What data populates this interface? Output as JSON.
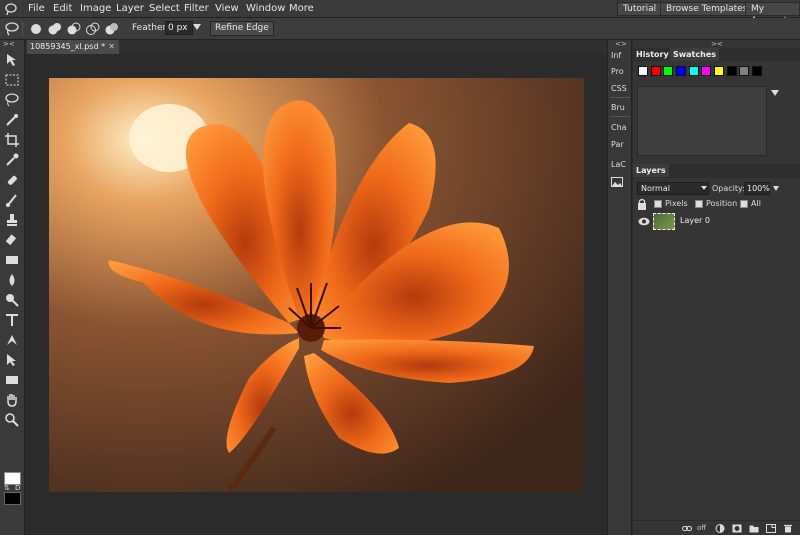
{
  "menu": {
    "items": [
      "File",
      "Edit",
      "Image",
      "Layer",
      "Select",
      "Filter",
      "View",
      "Window",
      "More"
    ],
    "right_buttons": [
      "Tutorial",
      "Browse Templates",
      "My Account"
    ]
  },
  "options": {
    "feather_label": "Feather:",
    "feather_value": "0 px",
    "refine_label": "Refine Edge"
  },
  "document": {
    "tab_title": "10859345_xl.psd *",
    "close_glyph": "✕"
  },
  "toolbar": {
    "collapse": "><",
    "fg_color": "#ffffff",
    "bg_color": "#000000",
    "swap_label": "⇅",
    "default_label": "D"
  },
  "minipanel": {
    "header": "<>",
    "items": [
      "Inf",
      "Pro",
      "CSS",
      "Bru",
      "Cha",
      "Par",
      "LaC"
    ]
  },
  "history_panel": {
    "header": "><",
    "tabs": [
      "History",
      "Swatches"
    ],
    "swatch_colors": [
      "#ffffff",
      "#ff0000",
      "#00ff00",
      "#0000ff",
      "#00ffff",
      "#ff00ff",
      "#ffff00",
      "#000000",
      "#808080",
      "#000000"
    ]
  },
  "layers_panel": {
    "tab": "Layers",
    "blend_mode": "Normal",
    "opacity_label": "Opacity:",
    "opacity_value": "100%",
    "lock_options": [
      "Pixels",
      "Position",
      "All"
    ],
    "layers": [
      {
        "name": "Layer 0"
      }
    ],
    "footer_text": "off"
  }
}
